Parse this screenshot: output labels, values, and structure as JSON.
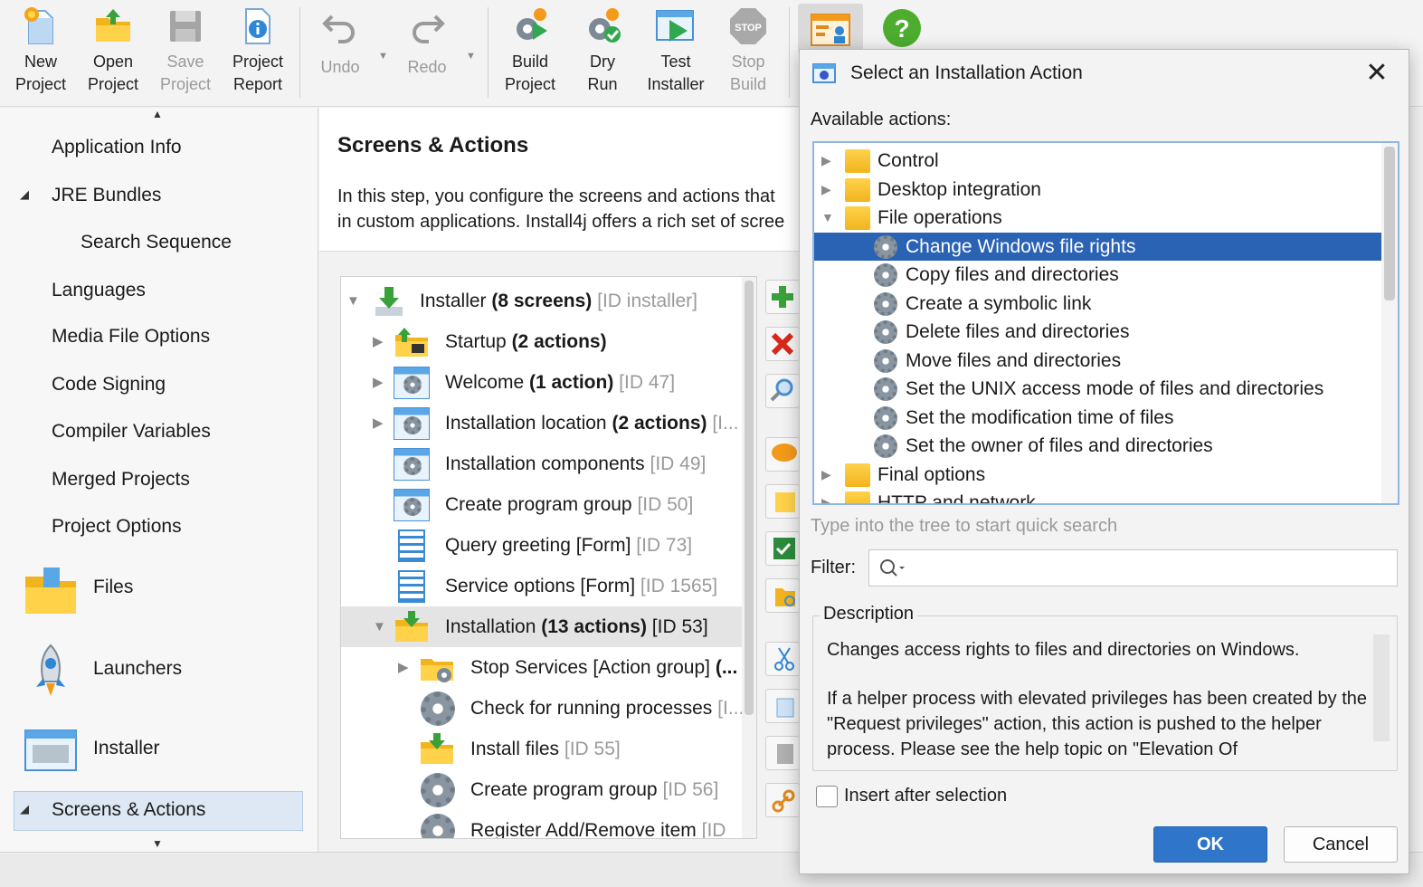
{
  "toolbar": {
    "new_project": "New\nProject",
    "new_project_l1": "New",
    "new_project_l2": "Project",
    "open_project_l1": "Open",
    "open_project_l2": "Project",
    "save_project_l1": "Save",
    "save_project_l2": "Project",
    "project_report_l1": "Project",
    "project_report_l2": "Report",
    "undo": "Undo",
    "redo": "Redo",
    "build_project_l1": "Build",
    "build_project_l2": "Project",
    "dry_run_l1": "Dry",
    "dry_run_l2": "Run",
    "test_installer_l1": "Test",
    "test_installer_l2": "Installer",
    "stop_build_l1": "Stop",
    "stop_build_l2": "Build",
    "stop_icon_text": "STOP"
  },
  "sidebar": {
    "items": [
      {
        "label": "Application Info"
      },
      {
        "label": "JRE Bundles"
      },
      {
        "label": "Search Sequence"
      },
      {
        "label": "Languages"
      },
      {
        "label": "Media File Options"
      },
      {
        "label": "Code Signing"
      },
      {
        "label": "Compiler Variables"
      },
      {
        "label": "Merged Projects"
      },
      {
        "label": "Project Options"
      },
      {
        "label": "Files"
      },
      {
        "label": "Launchers"
      },
      {
        "label": "Installer"
      },
      {
        "label": "Screens & Actions"
      }
    ]
  },
  "main": {
    "title": "Screens & Actions",
    "desc_line1": "In this step, you configure the screens and actions that",
    "desc_line2": "in custom applications. Install4j offers a rich set of scree",
    "tree": [
      {
        "name": "Installer",
        "bold": "(8 screens)",
        "id": "[ID installer]"
      },
      {
        "name": "Startup",
        "bold": "(2 actions)",
        "id": ""
      },
      {
        "name": "Welcome",
        "bold": "(1 action)",
        "id": "[ID 47]"
      },
      {
        "name": "Installation location",
        "bold": "(2 actions)",
        "id": "[I..."
      },
      {
        "name": "Installation components",
        "bold": "",
        "id": "[ID 49]"
      },
      {
        "name": "Create program group",
        "bold": "",
        "id": "[ID 50]"
      },
      {
        "name": "Query greeting [Form]",
        "bold": "",
        "id": "[ID 73]"
      },
      {
        "name": "Service options [Form]",
        "bold": "",
        "id": "[ID 1565]"
      },
      {
        "name": "Installation",
        "bold": "(13 actions)",
        "id": "[ID 53]"
      },
      {
        "name": "Stop Services [Action group]",
        "bold": "(...",
        "id": ""
      },
      {
        "name": "Check for running processes",
        "bold": "",
        "id": "[I..."
      },
      {
        "name": "Install files",
        "bold": "",
        "id": "[ID 55]"
      },
      {
        "name": "Create program group",
        "bold": "",
        "id": "[ID 56]"
      },
      {
        "name": "Register Add/Remove item",
        "bold": "",
        "id": "[ID"
      }
    ]
  },
  "dialog": {
    "title": "Select an Installation Action",
    "available_label": "Available actions:",
    "actions": [
      {
        "label": "Control",
        "type": "folder"
      },
      {
        "label": "Desktop integration",
        "type": "folder"
      },
      {
        "label": "File operations",
        "type": "folder"
      },
      {
        "label": "Change Windows file rights",
        "type": "action"
      },
      {
        "label": "Copy files and directories",
        "type": "action"
      },
      {
        "label": "Create a symbolic link",
        "type": "action"
      },
      {
        "label": "Delete files and directories",
        "type": "action"
      },
      {
        "label": "Move files and directories",
        "type": "action"
      },
      {
        "label": "Set the UNIX access mode of files and directories",
        "type": "action"
      },
      {
        "label": "Set the modification time of files",
        "type": "action"
      },
      {
        "label": "Set the owner of files and directories",
        "type": "action"
      },
      {
        "label": "Final options",
        "type": "folder"
      },
      {
        "label": "HTTP and network",
        "type": "folder"
      }
    ],
    "quick_search_hint": "Type into the tree to start quick search",
    "filter_label": "Filter:",
    "filter_value": "",
    "description_label": "Description",
    "description_p1": "Changes access rights to files and directories on Windows.",
    "description_p2": "If a helper process with elevated privileges has been created by the \"Request privileges\" action, this action is pushed to the helper process. Please see the help topic on \"Elevation Of",
    "insert_after_label": "Insert after selection",
    "ok_label": "OK",
    "cancel_label": "Cancel"
  },
  "colors": {
    "accent": "#2a62b4",
    "ok_button": "#2f75c9",
    "selection_light": "#dde8f4"
  }
}
